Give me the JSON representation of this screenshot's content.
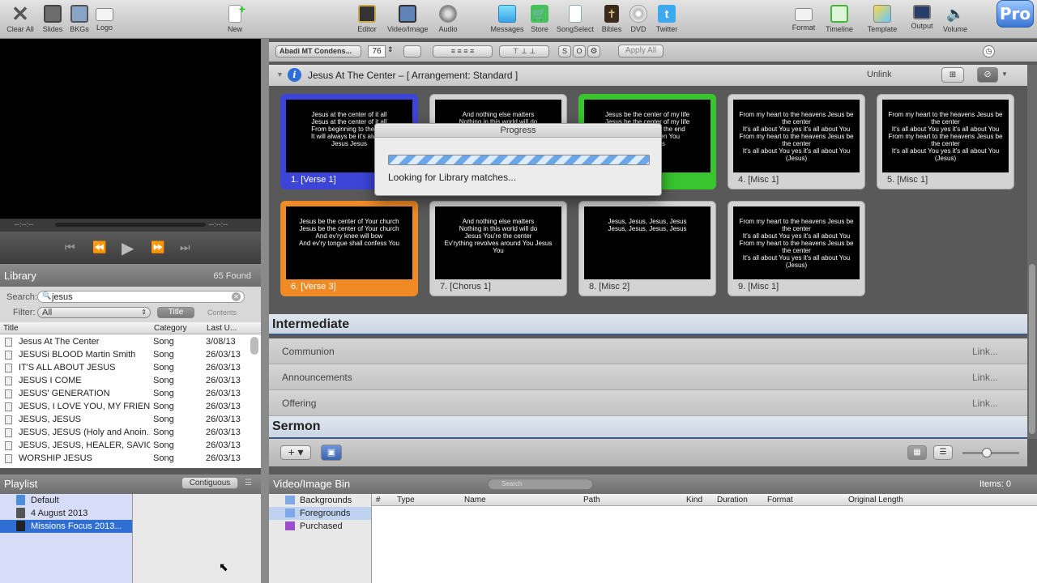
{
  "toolbar": {
    "left": [
      {
        "label": "Clear All",
        "icon": "x-icon"
      },
      {
        "label": "Slides",
        "icon": "slides-icon"
      },
      {
        "label": "BKGs",
        "icon": "bkgs-icon"
      },
      {
        "label": "Logo",
        "icon": "logo-icon"
      }
    ],
    "new_label": "New",
    "center": [
      {
        "label": "Editor",
        "icon": "editor-icon"
      },
      {
        "label": "Video/Image",
        "icon": "video-image-icon"
      },
      {
        "label": "Audio",
        "icon": "audio-icon"
      },
      {
        "label": "Messages",
        "icon": "messages-icon"
      },
      {
        "label": "Store",
        "icon": "cart-icon"
      },
      {
        "label": "SongSelect",
        "icon": "songselect-icon"
      },
      {
        "label": "Bibles",
        "icon": "bible-icon"
      },
      {
        "label": "DVD",
        "icon": "dvd-icon"
      },
      {
        "label": "Twitter",
        "icon": "twitter-icon"
      }
    ],
    "right": [
      {
        "label": "Format",
        "icon": "format-icon"
      },
      {
        "label": "Timeline",
        "icon": "timeline-icon"
      },
      {
        "label": "Template",
        "icon": "template-icon"
      },
      {
        "label": "Output",
        "icon": "output-icon"
      },
      {
        "label": "Volume",
        "icon": "volume-icon"
      }
    ],
    "pro_badge": "Pro"
  },
  "transport": {
    "time_left": "--:--:--",
    "time_right": "--:--:--"
  },
  "library": {
    "title": "Library",
    "found": "65 Found",
    "search_label": "Search:",
    "search_value": "jesus",
    "filter_label": "Filter:",
    "filter_value": "All",
    "title_toggle": "Title",
    "contents_toggle": "Contents",
    "columns": [
      "Title",
      "Category",
      "Last U..."
    ],
    "rows": [
      [
        "Jesus At The Center",
        "Song",
        "3/08/13"
      ],
      [
        "JESUSi BLOOD Martin Smith",
        "Song",
        "26/03/13"
      ],
      [
        "IT'S ALL ABOUT JESUS",
        "Song",
        "26/03/13"
      ],
      [
        "JESUS I COME",
        "Song",
        "26/03/13"
      ],
      [
        "JESUS' GENERATION",
        "Song",
        "26/03/13"
      ],
      [
        "JESUS, I LOVE YOU, MY FRIEND",
        "Song",
        "26/03/13"
      ],
      [
        "JESUS, JESUS",
        "Song",
        "26/03/13"
      ],
      [
        "JESUS, JESUS (Holy and Anoin...",
        "Song",
        "26/03/13"
      ],
      [
        "JESUS, JESUS, HEALER, SAVIOUR",
        "Song",
        "26/03/13"
      ],
      [
        "WORSHIP JESUS",
        "Song",
        "26/03/13"
      ]
    ]
  },
  "playlist": {
    "title": "Playlist",
    "mode": "Contiguous",
    "items": [
      {
        "label": "Default"
      },
      {
        "label": "4 August 2013"
      },
      {
        "label": "Missions Focus 2013..."
      }
    ]
  },
  "format_bar": {
    "font": "Abadi MT Condens...",
    "size": "76",
    "apply_all": "Apply All",
    "s_label": "S",
    "o_label": "O"
  },
  "document": {
    "title": "Jesus At The Center  – [ Arrangement: Standard ]",
    "unlink": "Unlink"
  },
  "slides": [
    {
      "label": "1. [Verse 1]",
      "text": "Jesus at the center of it all\nJesus at the center of it all\nFrom beginning to the end\nIt will always be it's always\nJesus Jesus",
      "color": "#3d45d8"
    },
    {
      "label": "",
      "text": "And nothing else matters\nNothing in this world will do",
      "color": "#d0d0d0"
    },
    {
      "label": "",
      "text": "Jesus be the center of my life\nJesus be the center of my life\nFrom beginning to the end\nIt will always been You\nJesus Jesus",
      "color": "#39c52f"
    },
    {
      "label": "4. [Misc 1]",
      "text": "From my heart to the heavens Jesus be the center\nIt's all about You yes it's all about You\nFrom my heart to the heavens Jesus be the center\nIt's all about You yes it's all about You\n(Jesus)",
      "color": "#d0d0d0"
    },
    {
      "label": "5. [Misc 1]",
      "text": "From my heart to the heavens Jesus be the center\nIt's all about You yes it's all about You\nFrom my heart to the heavens Jesus be the center\nIt's all about You yes it's all about You\n(Jesus)",
      "color": "#d0d0d0"
    },
    {
      "label": "6. [Verse 3]",
      "text": "Jesus be the center of Your church\nJesus be the center of Your church\nAnd ev'ry knee will bow\nAnd ev'ry tongue shall confess You",
      "color": "#f08a25"
    },
    {
      "label": "7. [Chorus 1]",
      "text": "And nothing else matters\nNothing in this world will do\nJesus You're the center\nEv'rything revolves around You Jesus You",
      "color": "#d0d0d0"
    },
    {
      "label": "8. [Misc 2]",
      "text": "Jesus, Jesus, Jesus, Jesus\nJesus, Jesus, Jesus, Jesus",
      "color": "#d0d0d0"
    },
    {
      "label": "9. [Misc 1]",
      "text": "From my heart to the heavens Jesus be the center\nIt's all about You yes it's all about You\nFrom my heart to the heavens Jesus be the center\nIt's all about You yes it's all about You\n(Jesus)",
      "color": "#d0d0d0"
    }
  ],
  "progress": {
    "title": "Progress",
    "message": "Looking for Library matches..."
  },
  "sections": {
    "intermediate": "Intermediate",
    "sermon": "Sermon",
    "items": [
      {
        "name": "Communion",
        "link": "Link..."
      },
      {
        "name": "Announcements",
        "link": "Link..."
      },
      {
        "name": "Offering",
        "link": "Link..."
      }
    ]
  },
  "bin": {
    "title": "Video/Image Bin",
    "search_placeholder": "Search",
    "items_count": "Items: 0",
    "folders": [
      "Backgrounds",
      "Foregrounds",
      "Purchased"
    ],
    "columns": [
      "#",
      "Type",
      "Name",
      "Path",
      "Kind",
      "Duration",
      "Format",
      "Original Length"
    ]
  }
}
